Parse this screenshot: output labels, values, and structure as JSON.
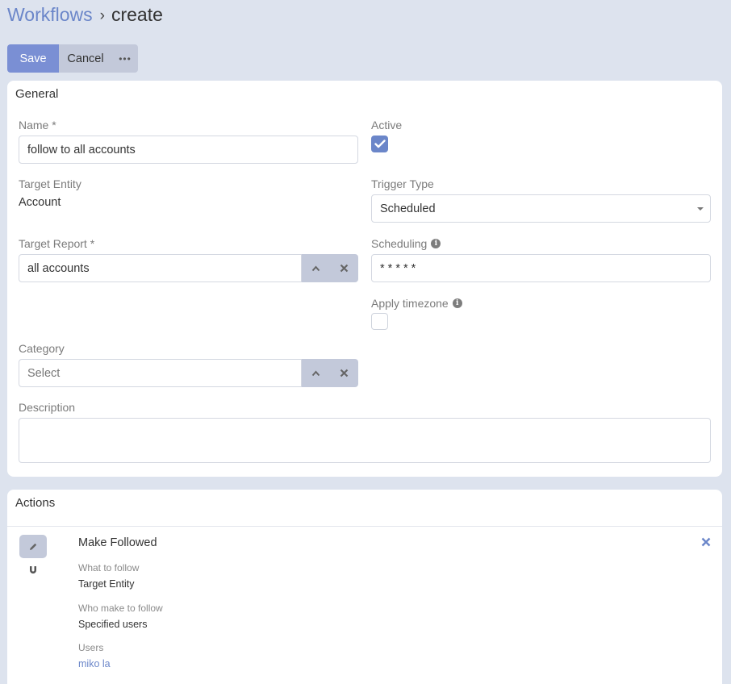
{
  "breadcrumb": {
    "parent": "Workflows",
    "separator": "›",
    "current": "create"
  },
  "toolbar": {
    "save_label": "Save",
    "cancel_label": "Cancel",
    "more_label": "•••"
  },
  "general": {
    "title": "General",
    "name_label": "Name *",
    "name_value": "follow to all accounts",
    "active_label": "Active",
    "active_checked": true,
    "target_entity_label": "Target Entity",
    "target_entity_value": "Account",
    "trigger_type_label": "Trigger Type",
    "trigger_type_value": "Scheduled",
    "target_report_label": "Target Report *",
    "target_report_value": "all accounts",
    "scheduling_label": "Scheduling",
    "scheduling_value": "* * * * *",
    "apply_timezone_label": "Apply timezone",
    "apply_timezone_checked": false,
    "category_label": "Category",
    "category_placeholder": "Select",
    "description_label": "Description",
    "description_value": ""
  },
  "actions": {
    "title": "Actions",
    "items": [
      {
        "title": "Make Followed",
        "what_label": "What to follow",
        "what_value": "Target Entity",
        "who_label": "Who make to follow",
        "who_value": "Specified users",
        "users_label": "Users",
        "users_value": "miko la"
      }
    ]
  },
  "colors": {
    "accent": "#6b86c9",
    "save_button": "#7a8fd4",
    "secondary_button": "#c3c9da",
    "background": "#dde3ee"
  },
  "icons": [
    "info-icon",
    "check-icon",
    "chevron-up-icon",
    "close-icon",
    "pencil-icon",
    "magnet-icon",
    "remove-icon"
  ]
}
